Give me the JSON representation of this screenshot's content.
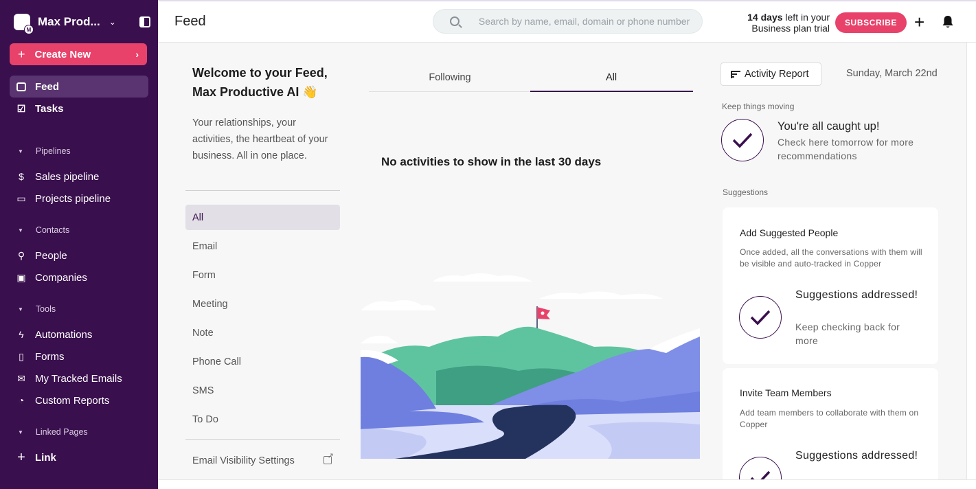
{
  "sidebar": {
    "workspace_name": "Max Prod...",
    "workspace_badge": "M",
    "create_new": "Create New",
    "items_top": [
      {
        "label": "Feed",
        "icon": "inbox-icon"
      },
      {
        "label": "Tasks",
        "icon": "check-square-icon"
      }
    ],
    "sections": [
      {
        "label": "Pipelines",
        "items": [
          {
            "label": "Sales pipeline",
            "icon": "dollar-icon",
            "glyph": "$"
          },
          {
            "label": "Projects pipeline",
            "icon": "briefcase-icon",
            "glyph": "▭"
          }
        ]
      },
      {
        "label": "Contacts",
        "items": [
          {
            "label": "People",
            "icon": "person-icon",
            "glyph": "⚲"
          },
          {
            "label": "Companies",
            "icon": "building-icon",
            "glyph": "▣"
          }
        ]
      },
      {
        "label": "Tools",
        "items": [
          {
            "label": "Automations",
            "icon": "lightning-icon",
            "glyph": "ϟ"
          },
          {
            "label": "Forms",
            "icon": "clipboard-icon",
            "glyph": "▯"
          },
          {
            "label": "My Tracked Emails",
            "icon": "mail-icon",
            "glyph": "✉"
          },
          {
            "label": "Custom Reports",
            "icon": "chart-icon",
            "glyph": "◔"
          }
        ]
      },
      {
        "label": "Linked Pages",
        "items": [
          {
            "label": "Link",
            "icon": "plus-icon",
            "glyph": "+"
          }
        ]
      }
    ]
  },
  "header": {
    "title": "Feed",
    "search_placeholder": "Search by name, email, domain or phone number",
    "trial_days": "14 days",
    "trial_rest": " left in your",
    "trial_line2": "Business plan trial",
    "subscribe": "SUBSCRIBE",
    "add_glyph": "+"
  },
  "feed": {
    "welcome_line1": "Welcome to your Feed,",
    "welcome_line2": "Max Productive AI 👋",
    "description": "Your relationships, your activities, the heartbeat of your business. All in one place.",
    "filters": [
      "All",
      "Email",
      "Form",
      "Meeting",
      "Note",
      "Phone Call",
      "SMS",
      "To Do"
    ],
    "active_filter": "All",
    "email_visibility": "Email Visibility Settings",
    "tabs": [
      "Following",
      "All"
    ],
    "active_tab": "All",
    "empty_message": "No activities to show in the last 30 days"
  },
  "right": {
    "activity_report": "Activity Report",
    "date": "Sunday, March 22nd",
    "keep_moving": "Keep things moving",
    "caught_title": "You're all caught up!",
    "caught_sub": "Check here tomorrow for more recommendations",
    "suggestions_label": "Suggestions",
    "cards": [
      {
        "title": "Add Suggested People",
        "desc": "Once added, all the conversations with them will be visible and auto-tracked in Copper",
        "status_title": "Suggestions addressed!",
        "status_sub": "Keep checking back for more"
      },
      {
        "title": "Invite Team Members",
        "desc": "Add team members to collaborate with them on Copper",
        "status_title": "Suggestions addressed!",
        "status_sub": ""
      }
    ]
  },
  "colors": {
    "sidebar_bg": "#3a0f4e",
    "accent_pink": "#e8426b",
    "accent_purple": "#3a0f4e",
    "mountain_green": "#5ec4a0",
    "mountain_blue": "#6f7fe0",
    "river_navy": "#24335e"
  }
}
